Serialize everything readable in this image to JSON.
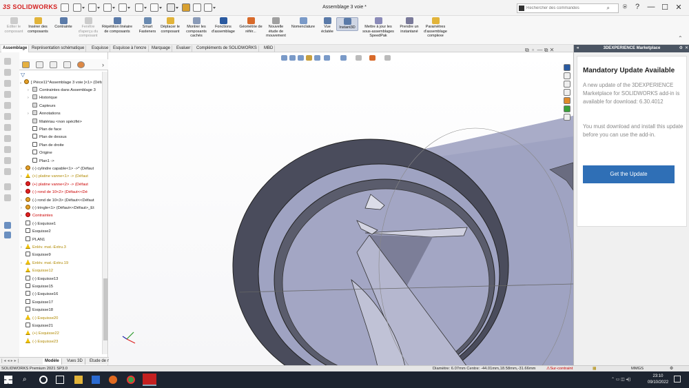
{
  "titlebar": {
    "logo": "SOLIDWORKS",
    "logo_prefix": "3S",
    "document_title": "Assemblage 3 voie *",
    "search_placeholder": "Rechercher des commandes",
    "minimize": "—",
    "maximize": "☐",
    "close": "✕",
    "help": "?",
    "user": "⍟"
  },
  "ribbon": {
    "buttons": [
      {
        "label": "Editer le composant",
        "state": "disabled"
      },
      {
        "label": "Insérer des composants",
        "state": "normal"
      },
      {
        "label": "Contrainte",
        "state": "normal"
      },
      {
        "label": "Fenêtre d'aperçu du composant",
        "state": "disabled"
      },
      {
        "label": "Répétition linéaire de composants",
        "state": "normal"
      },
      {
        "label": "Smart Fasteners",
        "state": "normal"
      },
      {
        "label": "Déplacer le composant",
        "state": "normal"
      },
      {
        "label": "Montrer les composants cachés",
        "state": "normal"
      },
      {
        "label": "Fonctions d'assemblage",
        "state": "normal"
      },
      {
        "label": "Géométrie de référ...",
        "state": "normal"
      },
      {
        "label": "Nouvelle étude de mouvement",
        "state": "normal"
      },
      {
        "label": "Nomenclature",
        "state": "normal"
      },
      {
        "label": "Vue éclatée",
        "state": "normal"
      },
      {
        "label": "Instant3D",
        "state": "active"
      },
      {
        "label": "Mettre à jour les sous-assemblages SpeedPak",
        "state": "normal"
      },
      {
        "label": "Prendre un instantané",
        "state": "normal"
      },
      {
        "label": "Paramètres d'assemblage complexe",
        "state": "normal"
      }
    ]
  },
  "tabs": [
    {
      "label": "Assemblage",
      "active": true
    },
    {
      "label": "Représentation schématique",
      "active": false
    },
    {
      "label": "Esquisse",
      "active": false
    },
    {
      "label": "Esquisse à l'encre",
      "active": false
    },
    {
      "label": "Marquage",
      "active": false
    },
    {
      "label": "Evaluer",
      "active": false
    },
    {
      "label": "Compléments de SOLIDWORKS",
      "active": false
    },
    {
      "label": "MBD",
      "active": false
    }
  ],
  "tree": {
    "root": "[ Pièce11^Assemblage 3 voie ]<1> (Défaut",
    "items": [
      {
        "label": "Contraintes dans Assemblage 3",
        "icon": "folder",
        "toggle": "›",
        "indent": 1,
        "style": ""
      },
      {
        "label": "Historique",
        "icon": "folder",
        "toggle": "›",
        "indent": 1,
        "style": ""
      },
      {
        "label": "Capteurs",
        "icon": "folder",
        "toggle": "",
        "indent": 1,
        "style": ""
      },
      {
        "label": "Annotations",
        "icon": "folder",
        "toggle": "›",
        "indent": 1,
        "style": ""
      },
      {
        "label": "Matériau <non spécifié>",
        "icon": "folder",
        "toggle": "",
        "indent": 1,
        "style": ""
      },
      {
        "label": "Plan de face",
        "icon": "sketch",
        "toggle": "",
        "indent": 1,
        "style": ""
      },
      {
        "label": "Plan de dessus",
        "icon": "sketch",
        "toggle": "",
        "indent": 1,
        "style": ""
      },
      {
        "label": "Plan de droite",
        "icon": "sketch",
        "toggle": "",
        "indent": 1,
        "style": ""
      },
      {
        "label": "Origine",
        "icon": "sketch",
        "toggle": "",
        "indent": 1,
        "style": ""
      },
      {
        "label": "Plan1 ->",
        "icon": "sketch",
        "toggle": "",
        "indent": 1,
        "style": ""
      },
      {
        "label": "(-) cylindre capable<1> ->* (Défaut",
        "icon": "asm",
        "toggle": "›",
        "indent": 0,
        "style": ""
      },
      {
        "label": "(+) platine vanne<1> -> (Défaut",
        "icon": "warn",
        "toggle": "›",
        "indent": 0,
        "style": "warn"
      },
      {
        "label": "(+) platine vanne<2> -> (Défaut",
        "icon": "err",
        "toggle": "›",
        "indent": 0,
        "style": "err"
      },
      {
        "label": "(-) rond de 10<2> (Défaut<<Dé",
        "icon": "err",
        "toggle": "›",
        "indent": 0,
        "style": "err"
      },
      {
        "label": "(-) rond de 10<3> (Défaut<<Défaut",
        "icon": "asm",
        "toggle": "›",
        "indent": 0,
        "style": ""
      },
      {
        "label": "(-) tringle<1> (Défaut<<Défaut>_Et",
        "icon": "asm",
        "toggle": "›",
        "indent": 0,
        "style": ""
      },
      {
        "label": "Contraintes",
        "icon": "err",
        "toggle": "›",
        "indent": 0,
        "style": "err"
      },
      {
        "label": "(-) Esquisse1",
        "icon": "sketch",
        "toggle": "",
        "indent": 0,
        "style": ""
      },
      {
        "label": "Esquisse2",
        "icon": "sketch",
        "toggle": "",
        "indent": 0,
        "style": ""
      },
      {
        "label": "PLAN1",
        "icon": "sketch",
        "toggle": "",
        "indent": 0,
        "style": ""
      },
      {
        "label": "Enlév. mat.-Extru.3",
        "icon": "warn",
        "toggle": "›",
        "indent": 0,
        "style": "warn"
      },
      {
        "label": "Esquisse9",
        "icon": "sketch",
        "toggle": "",
        "indent": 0,
        "style": ""
      },
      {
        "label": "Enlév. mat.-Extru.19",
        "icon": "warn",
        "toggle": "›",
        "indent": 0,
        "style": "warn"
      },
      {
        "label": "Esquisse12",
        "icon": "warn",
        "toggle": "",
        "indent": 0,
        "style": "warn"
      },
      {
        "label": "(-) Esquisse13",
        "icon": "sketch",
        "toggle": "",
        "indent": 0,
        "style": ""
      },
      {
        "label": "Esquisse15",
        "icon": "sketch",
        "toggle": "",
        "indent": 0,
        "style": ""
      },
      {
        "label": "(-) Esquisse16",
        "icon": "sketch",
        "toggle": "",
        "indent": 0,
        "style": ""
      },
      {
        "label": "Esquisse17",
        "icon": "sketch",
        "toggle": "",
        "indent": 0,
        "style": ""
      },
      {
        "label": "Esquisse18",
        "icon": "sketch",
        "toggle": "",
        "indent": 0,
        "style": ""
      },
      {
        "label": "(-) Esquisse20",
        "icon": "warn",
        "toggle": "",
        "indent": 0,
        "style": "warn"
      },
      {
        "label": "Esquisse21",
        "icon": "sketch",
        "toggle": "",
        "indent": 0,
        "style": ""
      },
      {
        "label": "(+) Esquisse22",
        "icon": "warn",
        "toggle": "",
        "indent": 0,
        "style": "warn"
      },
      {
        "label": "(-) Esquisse23",
        "icon": "warn",
        "toggle": "",
        "indent": 0,
        "style": "warn"
      }
    ]
  },
  "bottom_tabs": [
    {
      "label": "Modèle",
      "active": true
    },
    {
      "label": "Vues 3D",
      "active": false
    },
    {
      "label": "Etude de mouvement 1",
      "active": false
    }
  ],
  "taskpane": {
    "header": "3DEXPERIENCE Marketplace",
    "title": "Mandatory Update Available",
    "p1": "A new update of the 3DEXPERIENCE Marketplace for SOLIDWORKS add-in is available for download: 6.30.4012",
    "p2": "You must download and install this update before you can use the add-in.",
    "button": "Get the Update"
  },
  "statusbar": {
    "product": "SOLIDWORKS Premium 2021 SP3.0",
    "measure": "Diamètre: 6.07mm  Centre: -44.01mm,18.58mm,-31.66mm",
    "constraint": "Sur-contraint",
    "units": "MMGS"
  },
  "taskbar": {
    "time": "23:10",
    "date": "09/10/2022"
  },
  "colors": {
    "accent": "#2f6fb6",
    "model_face": "#9fa3c2",
    "model_dark": "#4a4c5c",
    "warning": "#f2c200",
    "error": "#d22222"
  }
}
